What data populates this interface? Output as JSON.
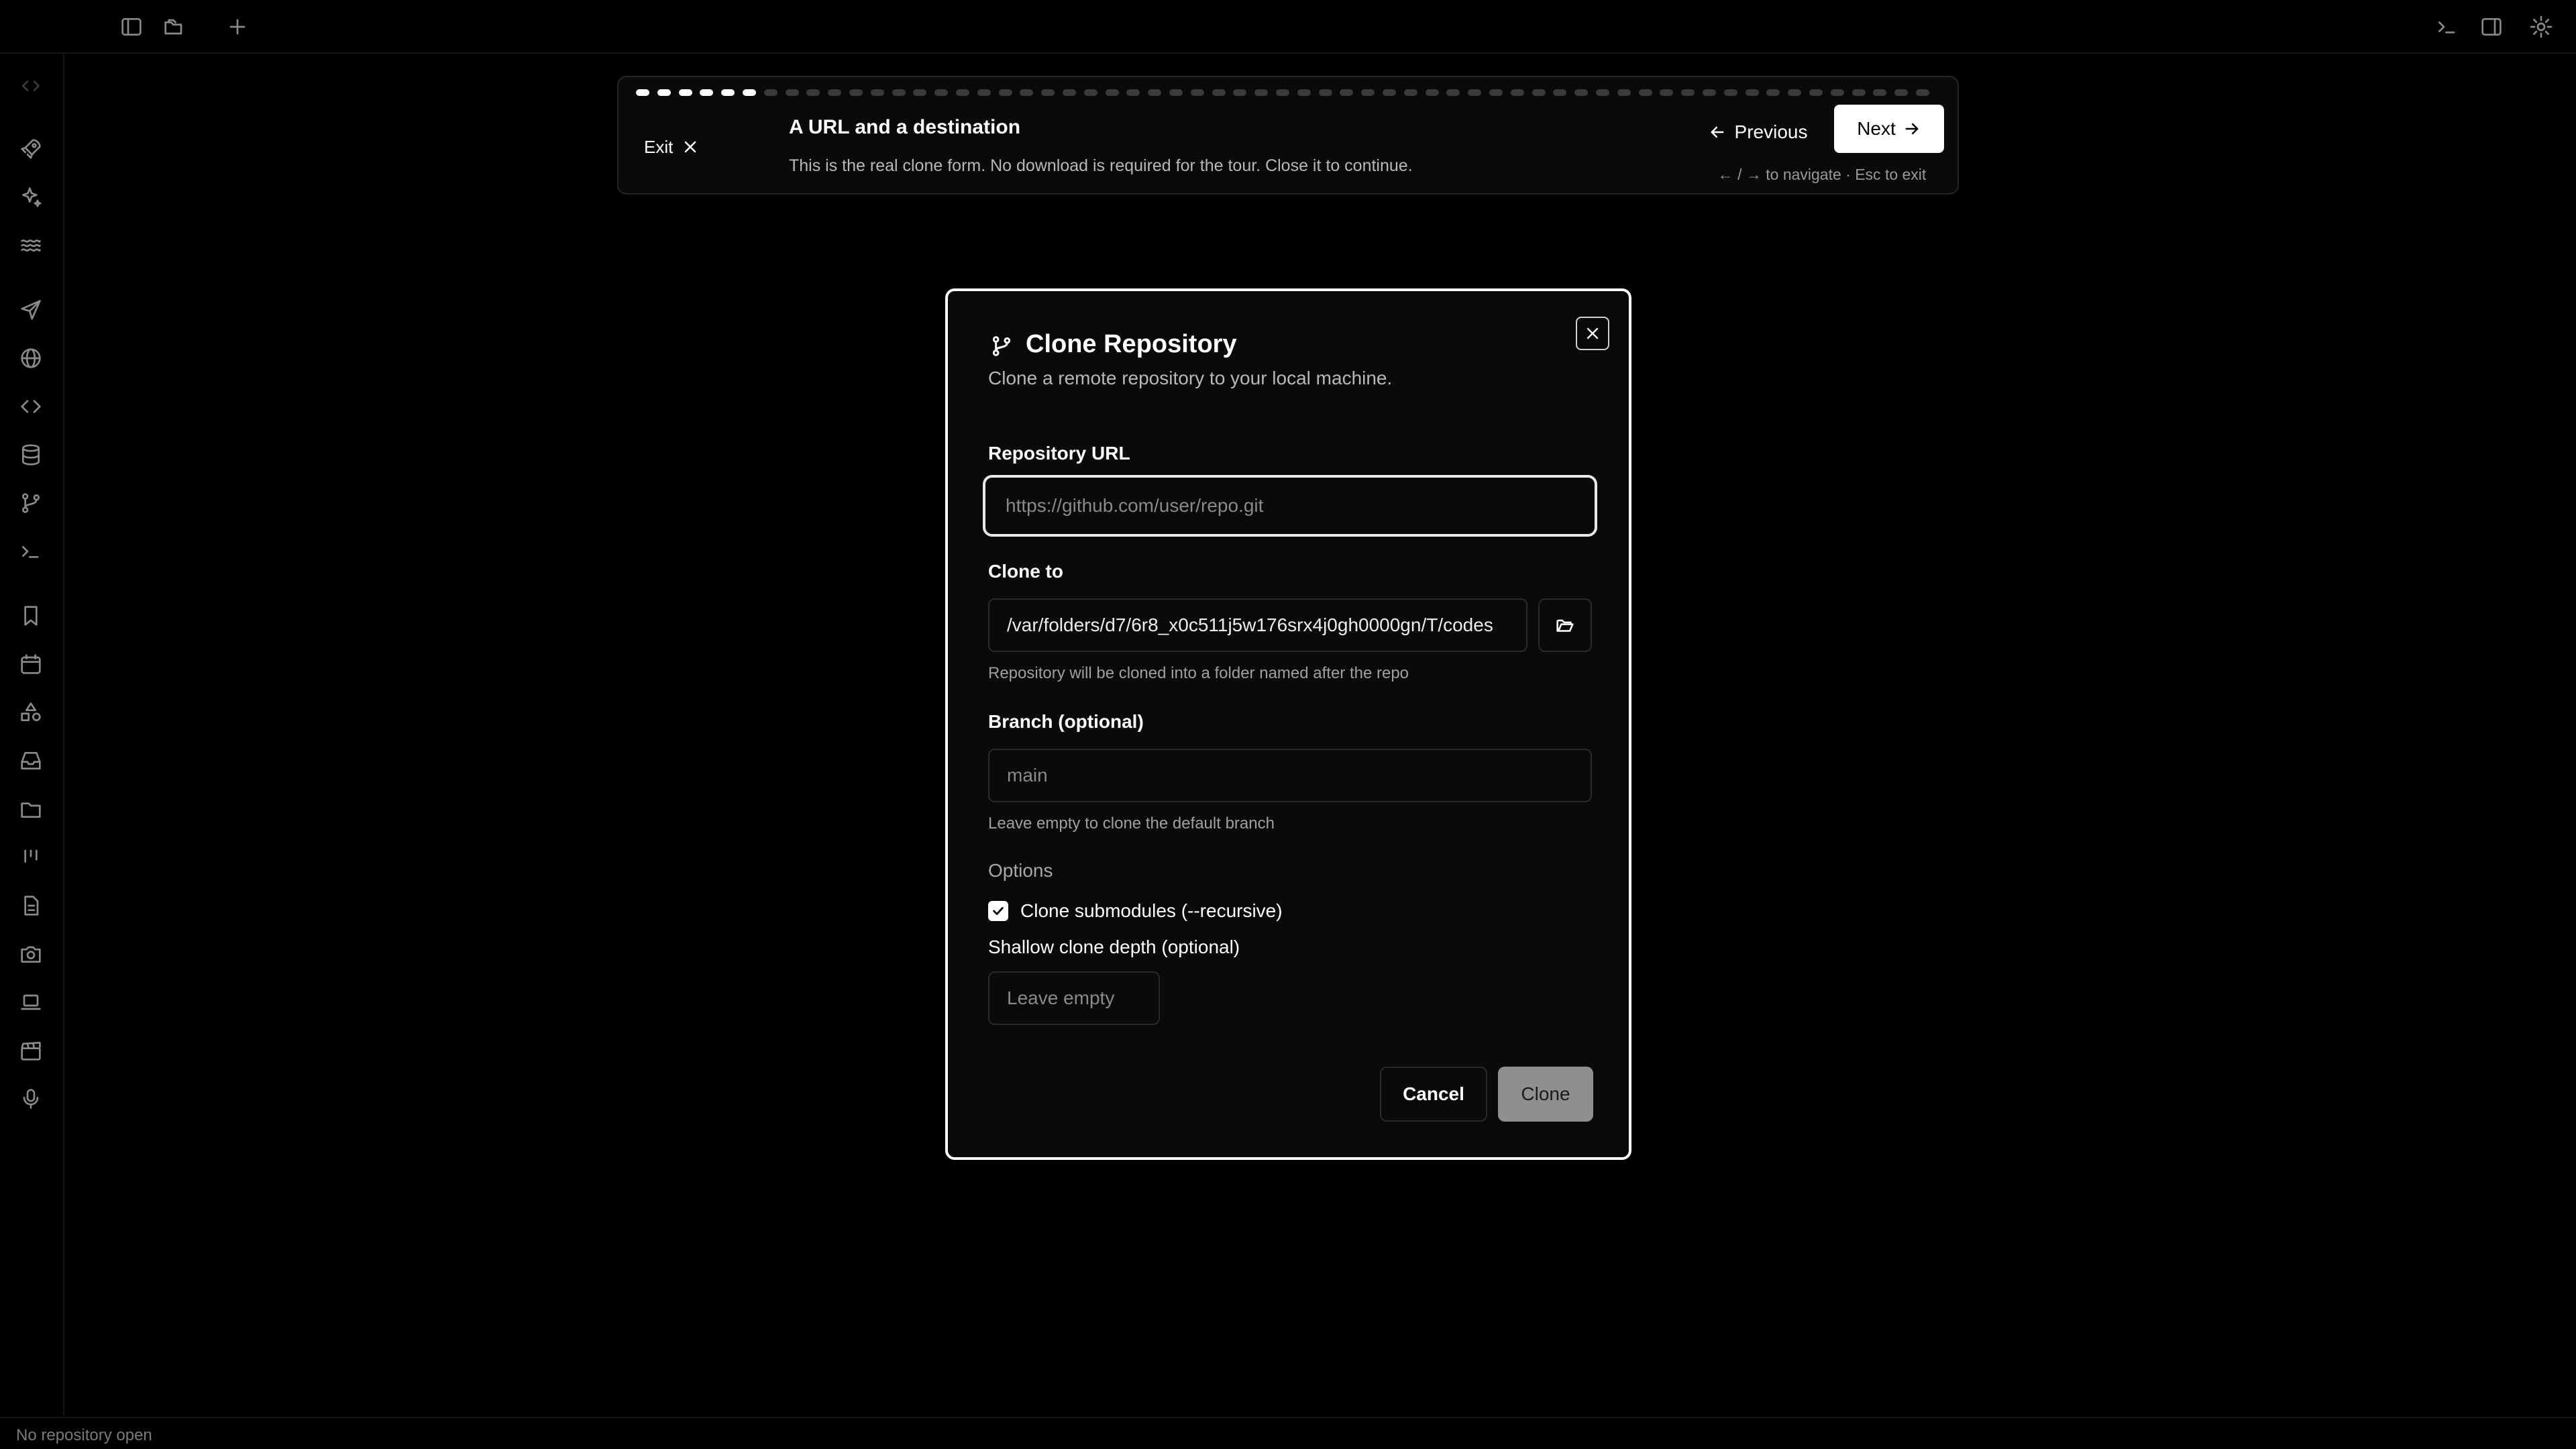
{
  "status_bar": {
    "text": "No repository open"
  },
  "tour": {
    "total_steps": 61,
    "current_step": 6,
    "exit_label": "Exit",
    "title": "A URL and a destination",
    "description": "This is the real clone form. No download is required for the tour. Close it to continue.",
    "previous_label": "Previous",
    "next_label": "Next",
    "hint": "← / → to navigate · Esc to exit"
  },
  "dialog": {
    "title": "Clone Repository",
    "subtitle": "Clone a remote repository to your local machine.",
    "repo_url": {
      "label": "Repository URL",
      "value": "",
      "placeholder": "https://github.com/user/repo.git"
    },
    "clone_to": {
      "label": "Clone to",
      "value": "/var/folders/d7/6r8_x0c511j5w176srx4j0gh0000gn/T/codes",
      "help": "Repository will be cloned into a folder named after the repo"
    },
    "branch": {
      "label": "Branch (optional)",
      "placeholder": "main",
      "help": "Leave empty to clone the default branch"
    },
    "options_label": "Options",
    "submodules": {
      "label": "Clone submodules (--recursive)",
      "checked": true
    },
    "depth": {
      "label": "Shallow clone depth (optional)",
      "placeholder": "Leave empty"
    },
    "cancel_label": "Cancel",
    "clone_label": "Clone"
  },
  "colors": {
    "background": "#000000",
    "panel": "#0a0a0a",
    "accent": "#ffffff",
    "muted_text": "#a0a0a0",
    "disabled_button": "#8f8f8f"
  }
}
